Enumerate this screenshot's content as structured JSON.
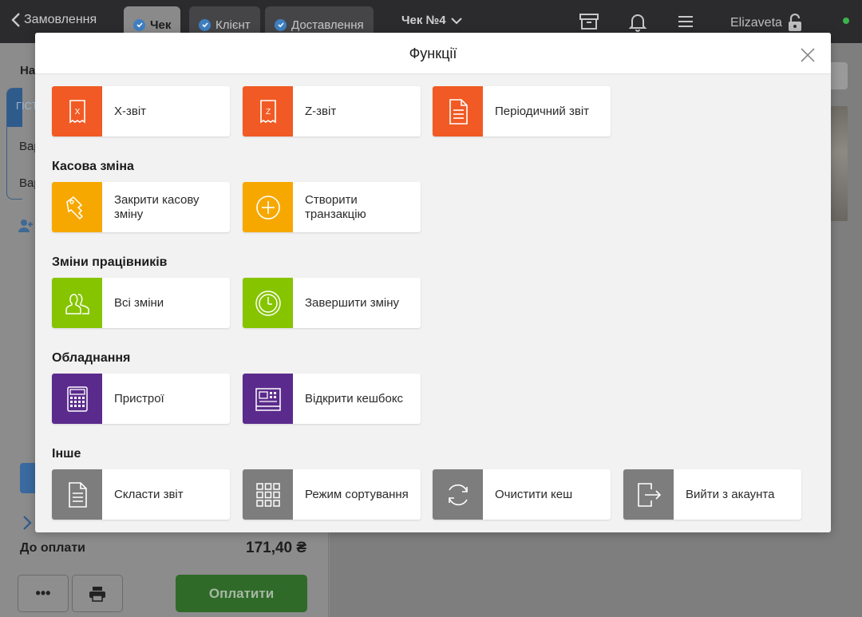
{
  "topbar": {
    "back_label": "Замовлення",
    "tabs": [
      {
        "label": "Чек",
        "active": true
      },
      {
        "label": "Клієнт",
        "active": false
      },
      {
        "label": "Доставлення",
        "active": false
      }
    ],
    "order_title": "Чек №4",
    "user_name": "Elizaveta",
    "icons": [
      "archive-icon",
      "bell-icon",
      "menu-icon",
      "lock-open-icon"
    ],
    "status_color": "#3bb34a"
  },
  "left_panel": {
    "partial_heading": "На",
    "partial_guest": "ГІСТ",
    "partial_rows": [
      "Вар",
      "Вар"
    ],
    "total_label": "До оплати",
    "total_value": "171,40 ₴",
    "more_label": "•••",
    "pay_label": "Оплатити"
  },
  "modal": {
    "title": "Функції",
    "sections": [
      {
        "title": "",
        "items": [
          {
            "label": "X-звіт",
            "color": "#f15a24",
            "icon": "x-report-icon"
          },
          {
            "label": "Z-звіт",
            "color": "#f15a24",
            "icon": "z-report-icon"
          },
          {
            "label": "Періодичний звіт",
            "color": "#f15a24",
            "icon": "document-icon"
          }
        ]
      },
      {
        "title": "Касова зміна",
        "items": [
          {
            "label": "Закрити касову зміну",
            "color": "#f7a800",
            "icon": "keys-icon"
          },
          {
            "label": "Створити транзакцію",
            "color": "#f7a800",
            "icon": "plus-circle-icon"
          }
        ]
      },
      {
        "title": "Зміни працівників",
        "items": [
          {
            "label": "Всі зміни",
            "color": "#86c400",
            "icon": "users-icon"
          },
          {
            "label": "Завершити зміну",
            "color": "#86c400",
            "icon": "clock-icon"
          }
        ]
      },
      {
        "title": "Обладнання",
        "items": [
          {
            "label": "Пристрої",
            "color": "#5a2b8c",
            "icon": "calculator-icon"
          },
          {
            "label": "Відкрити кешбокс",
            "color": "#5a2b8c",
            "icon": "cash-register-icon"
          }
        ]
      },
      {
        "title": "Інше",
        "items": [
          {
            "label": "Скласти звіт",
            "color": "#7d7d7d",
            "icon": "report-icon"
          },
          {
            "label": "Режим сортування",
            "color": "#7d7d7d",
            "icon": "grid-icon"
          },
          {
            "label": "Очистити кеш",
            "color": "#7d7d7d",
            "icon": "refresh-icon"
          },
          {
            "label": "Вийти з акаунта",
            "color": "#7d7d7d",
            "icon": "logout-icon"
          }
        ]
      }
    ]
  }
}
